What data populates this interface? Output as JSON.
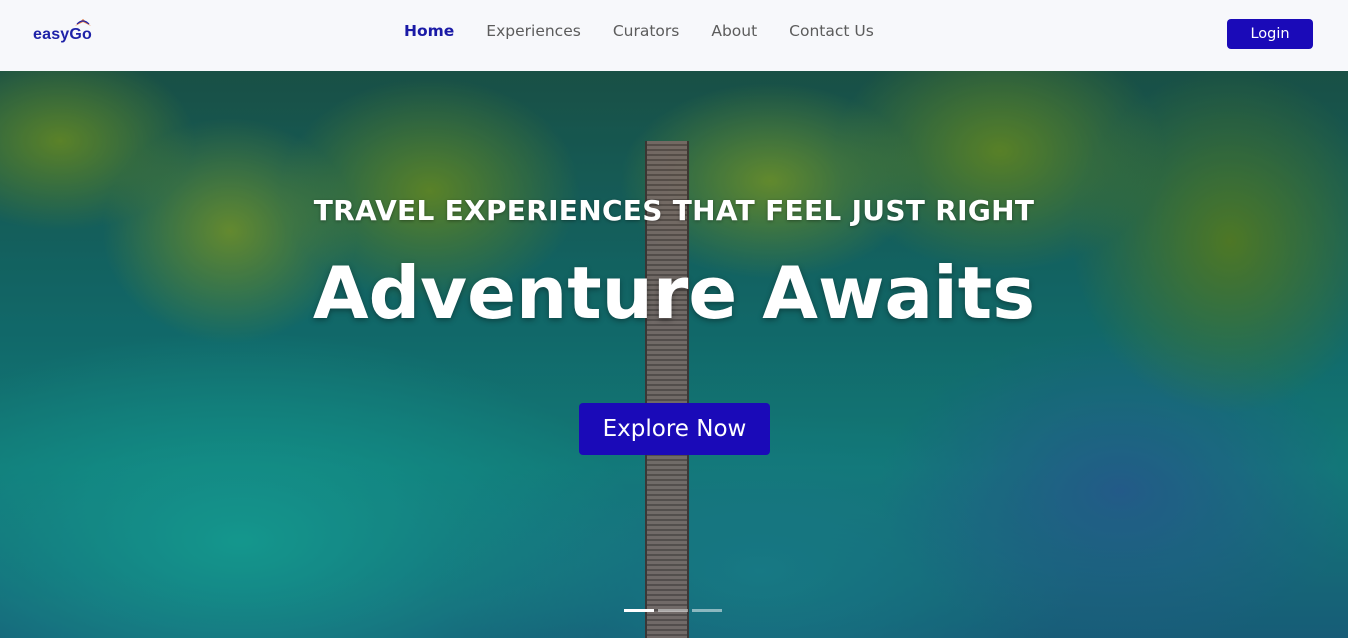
{
  "brand": {
    "name": "easyGo",
    "logo_icon": "open-book-icon"
  },
  "nav": {
    "items": [
      {
        "label": "Home",
        "active": true
      },
      {
        "label": "Experiences",
        "active": false
      },
      {
        "label": "Curators",
        "active": false
      },
      {
        "label": "About",
        "active": false
      },
      {
        "label": "Contact Us",
        "active": false
      }
    ],
    "login_label": "Login"
  },
  "hero": {
    "subtitle": "TRAVEL EXPERIENCES THAT FEEL JUST RIGHT",
    "title": "Adventure Awaits",
    "cta_label": "Explore Now",
    "slides": {
      "count": 3,
      "active_index": 0
    }
  },
  "colors": {
    "accent": "#1a0ab8",
    "nav_active": "#1a1aa6",
    "nav_text": "#5c5c5c",
    "navbar_bg": "#f7f8fb"
  }
}
